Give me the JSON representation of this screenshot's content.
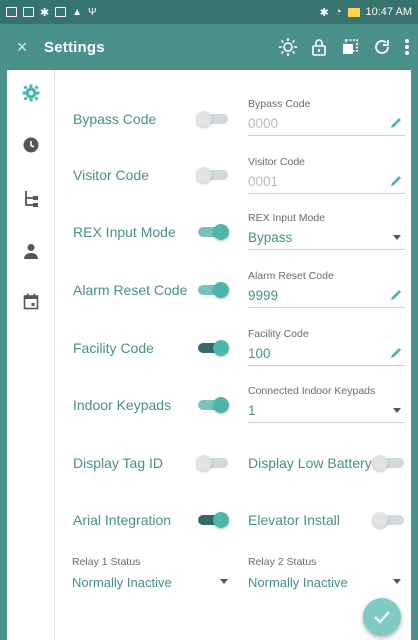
{
  "status_bar": {
    "time": "10:47 AM"
  },
  "app_bar": {
    "close_glyph": "×",
    "title": "Settings"
  },
  "nav_rail": [
    {
      "icon": "gear-icon"
    },
    {
      "icon": "clock-icon"
    },
    {
      "icon": "tree-icon"
    },
    {
      "icon": "person-icon"
    },
    {
      "icon": "calendar-icon"
    }
  ],
  "rows": [
    {
      "label": "Bypass Code",
      "toggle": "off",
      "field_caption": "Bypass Code",
      "field_value": "0000",
      "field_dim": true,
      "field_kind": "edit"
    },
    {
      "label": "Visitor Code",
      "toggle": "off",
      "field_caption": "Visitor Code",
      "field_value": "0001",
      "field_dim": true,
      "field_kind": "edit"
    },
    {
      "label": "REX Input Mode",
      "toggle": "on",
      "field_caption": "REX Input Mode",
      "field_value": "Bypass",
      "field_dim": false,
      "field_kind": "select"
    },
    {
      "label": "Alarm Reset Code",
      "toggle": "on",
      "field_caption": "Alarm Reset Code",
      "field_value": "9999",
      "field_dim": false,
      "field_kind": "edit"
    },
    {
      "label": "Facility Code",
      "toggle": "dark",
      "field_caption": "Facility Code",
      "field_value": "100",
      "field_dim": false,
      "field_kind": "edit"
    },
    {
      "label": "Indoor Keypads",
      "toggle": "on",
      "field_caption": "Connected Indoor Keypads",
      "field_value": "1",
      "field_dim": false,
      "field_kind": "select"
    }
  ],
  "toggle_pairs": [
    {
      "left_label": "Display Tag ID",
      "left_toggle": "off",
      "right_label": "Display Low Battery",
      "right_toggle": "off"
    },
    {
      "left_label": "Arial Integration",
      "left_toggle": "dark",
      "right_label": "Elevator Install",
      "right_toggle": "off"
    }
  ],
  "relays": [
    {
      "caption": "Relay 1 Status",
      "value": "Normally Inactive"
    },
    {
      "caption": "Relay 2 Status",
      "value": "Normally Inactive"
    }
  ],
  "colors": {
    "primary": "#4b918b",
    "accent": "#4db6ac",
    "text_teal": "#47908a"
  }
}
